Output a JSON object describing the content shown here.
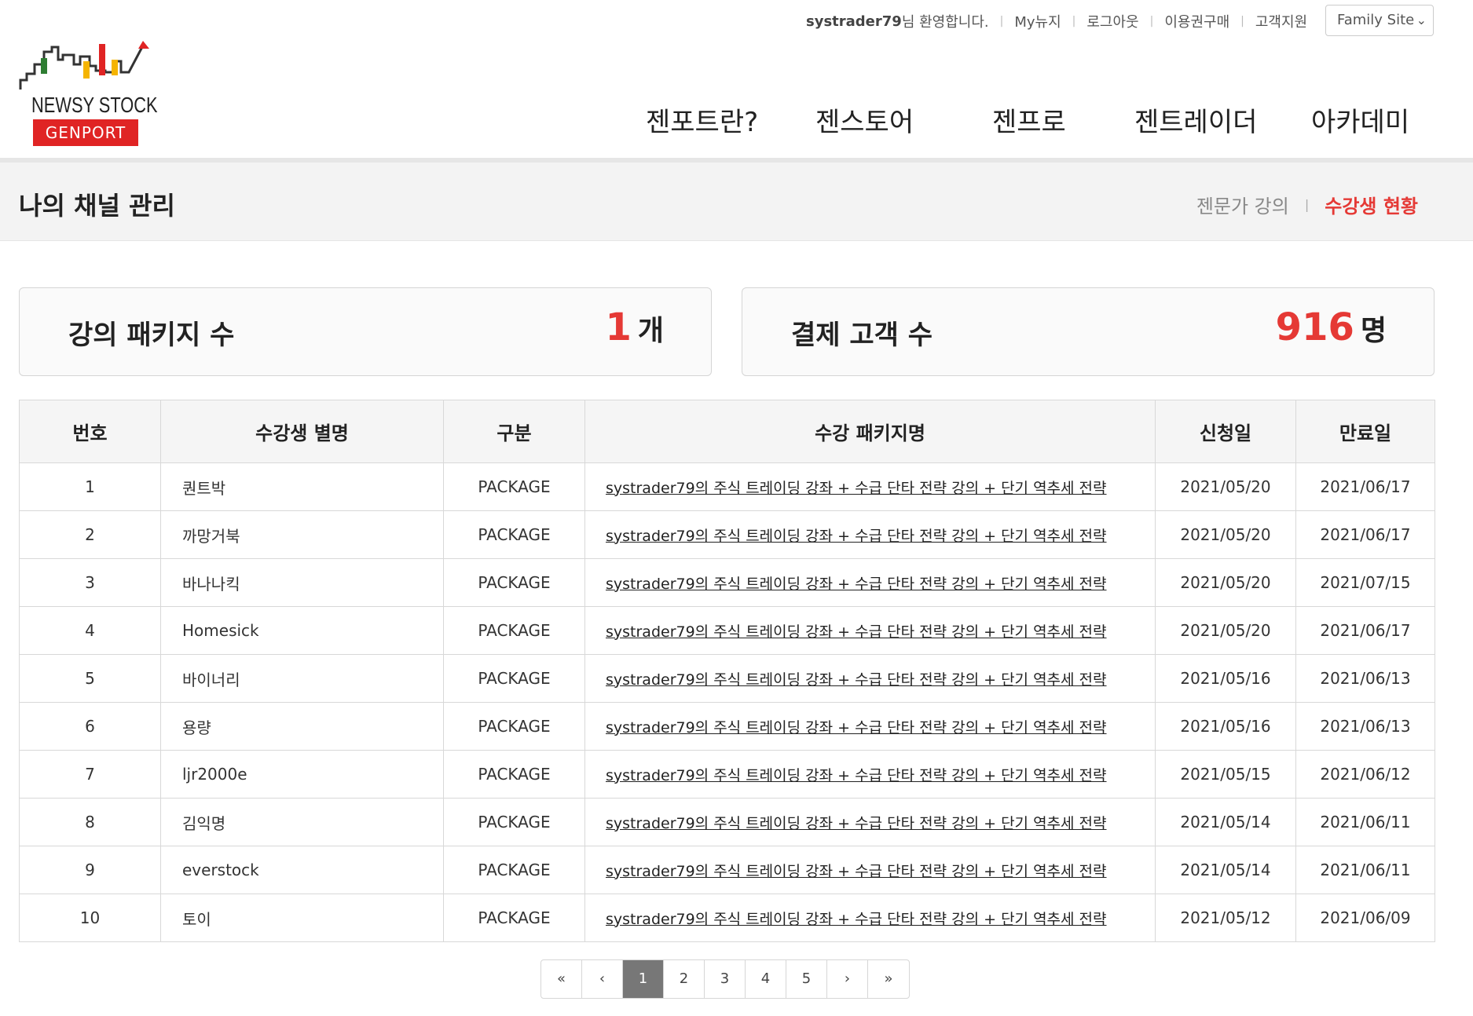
{
  "header": {
    "logo": {
      "brand": "NEWSY STOCK",
      "sub": "GENPORT"
    },
    "util": {
      "user": "systrader79",
      "greeting": "님 환영합니다.",
      "links": [
        "My뉴지",
        "로그아웃",
        "이용권구매",
        "고객지원"
      ]
    },
    "family_site": "Family Site",
    "nav": [
      "젠포트란?",
      "젠스토어",
      "젠프로",
      "젠트레이더",
      "아카데미"
    ]
  },
  "subheader": {
    "title": "나의 채널 관리",
    "tab_lecture": "젠문가 강의",
    "tab_students": "수강생 현황",
    "active_color": "#e53935"
  },
  "stats": {
    "packages": {
      "label": "강의 패키지 수",
      "value": "1",
      "unit": "개"
    },
    "customers": {
      "label": "결제 고객 수",
      "value": "916",
      "unit": "명"
    }
  },
  "table": {
    "headers": [
      "번호",
      "수강생 별명",
      "구분",
      "수강 패키지명",
      "신청일",
      "만료일"
    ],
    "rows": [
      {
        "no": "1",
        "nick": "퀀트박",
        "type": "PACKAGE",
        "package": "systrader79의 주식 트레이딩 강좌 + 수급 단타 전략 강의 + 단기 역추세 전략",
        "start": "2021/05/20",
        "end": "2021/06/17"
      },
      {
        "no": "2",
        "nick": "까망거북",
        "type": "PACKAGE",
        "package": "systrader79의 주식 트레이딩 강좌 + 수급 단타 전략 강의 + 단기 역추세 전략",
        "start": "2021/05/20",
        "end": "2021/06/17"
      },
      {
        "no": "3",
        "nick": "바나나킥",
        "type": "PACKAGE",
        "package": "systrader79의 주식 트레이딩 강좌 + 수급 단타 전략 강의 + 단기 역추세 전략",
        "start": "2021/05/20",
        "end": "2021/07/15"
      },
      {
        "no": "4",
        "nick": "Homesick",
        "type": "PACKAGE",
        "package": "systrader79의 주식 트레이딩 강좌 + 수급 단타 전략 강의 + 단기 역추세 전략",
        "start": "2021/05/20",
        "end": "2021/06/17"
      },
      {
        "no": "5",
        "nick": "바이너리",
        "type": "PACKAGE",
        "package": "systrader79의 주식 트레이딩 강좌 + 수급 단타 전략 강의 + 단기 역추세 전략",
        "start": "2021/05/16",
        "end": "2021/06/13"
      },
      {
        "no": "6",
        "nick": "용량",
        "type": "PACKAGE",
        "package": "systrader79의 주식 트레이딩 강좌 + 수급 단타 전략 강의 + 단기 역추세 전략",
        "start": "2021/05/16",
        "end": "2021/06/13"
      },
      {
        "no": "7",
        "nick": "ljr2000e",
        "type": "PACKAGE",
        "package": "systrader79의 주식 트레이딩 강좌 + 수급 단타 전략 강의 + 단기 역추세 전략",
        "start": "2021/05/15",
        "end": "2021/06/12"
      },
      {
        "no": "8",
        "nick": "김익명",
        "type": "PACKAGE",
        "package": "systrader79의 주식 트레이딩 강좌 + 수급 단타 전략 강의 + 단기 역추세 전략",
        "start": "2021/05/14",
        "end": "2021/06/11"
      },
      {
        "no": "9",
        "nick": "everstock",
        "type": "PACKAGE",
        "package": "systrader79의 주식 트레이딩 강좌 + 수급 단타 전략 강의 + 단기 역추세 전략",
        "start": "2021/05/14",
        "end": "2021/06/11"
      },
      {
        "no": "10",
        "nick": "토이",
        "type": "PACKAGE",
        "package": "systrader79의 주식 트레이딩 강좌 + 수급 단타 전략 강의 + 단기 역추세 전략",
        "start": "2021/05/12",
        "end": "2021/06/09"
      }
    ]
  },
  "pagination": {
    "first": "«",
    "prev": "‹",
    "pages": [
      "1",
      "2",
      "3",
      "4",
      "5"
    ],
    "current": "1",
    "next": "›",
    "last": "»"
  }
}
